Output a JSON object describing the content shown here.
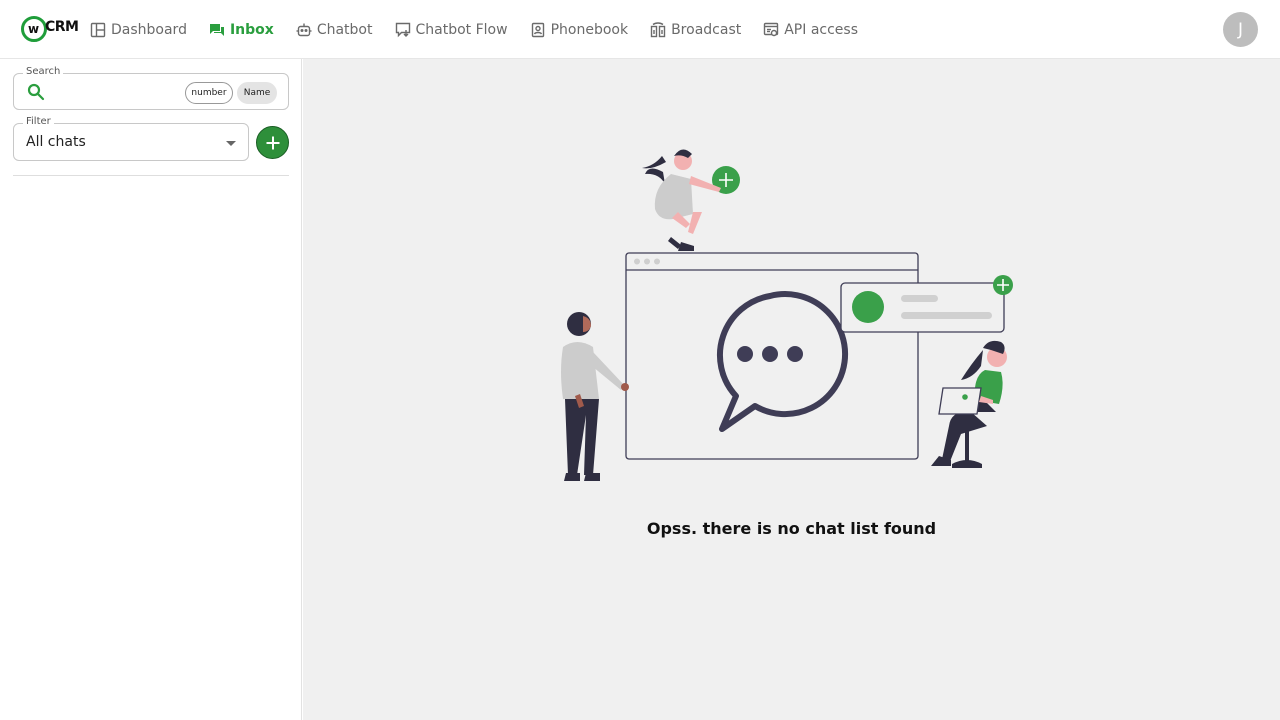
{
  "app": {
    "logo_mark": "w",
    "logo_text": "CRM"
  },
  "nav": {
    "items": [
      {
        "label": "Dashboard",
        "icon": "dashboard-icon"
      },
      {
        "label": "Inbox",
        "icon": "inbox-icon",
        "active": true
      },
      {
        "label": "Chatbot",
        "icon": "robot-icon"
      },
      {
        "label": "Chatbot Flow",
        "icon": "flow-icon"
      },
      {
        "label": "Phonebook",
        "icon": "phonebook-icon"
      },
      {
        "label": "Broadcast",
        "icon": "broadcast-icon"
      },
      {
        "label": "API access",
        "icon": "api-icon"
      }
    ]
  },
  "user": {
    "initial": "J"
  },
  "sidebar": {
    "search": {
      "label": "Search",
      "value": "",
      "chips": [
        "number",
        "Name"
      ]
    },
    "filter": {
      "label": "Filter",
      "value": "All chats"
    }
  },
  "main": {
    "empty_message": "Opss. there is no chat list found"
  },
  "colors": {
    "accent": "#2a9e3e",
    "brand_dark": "#2e8f3a",
    "background": "#f0f0f0"
  }
}
